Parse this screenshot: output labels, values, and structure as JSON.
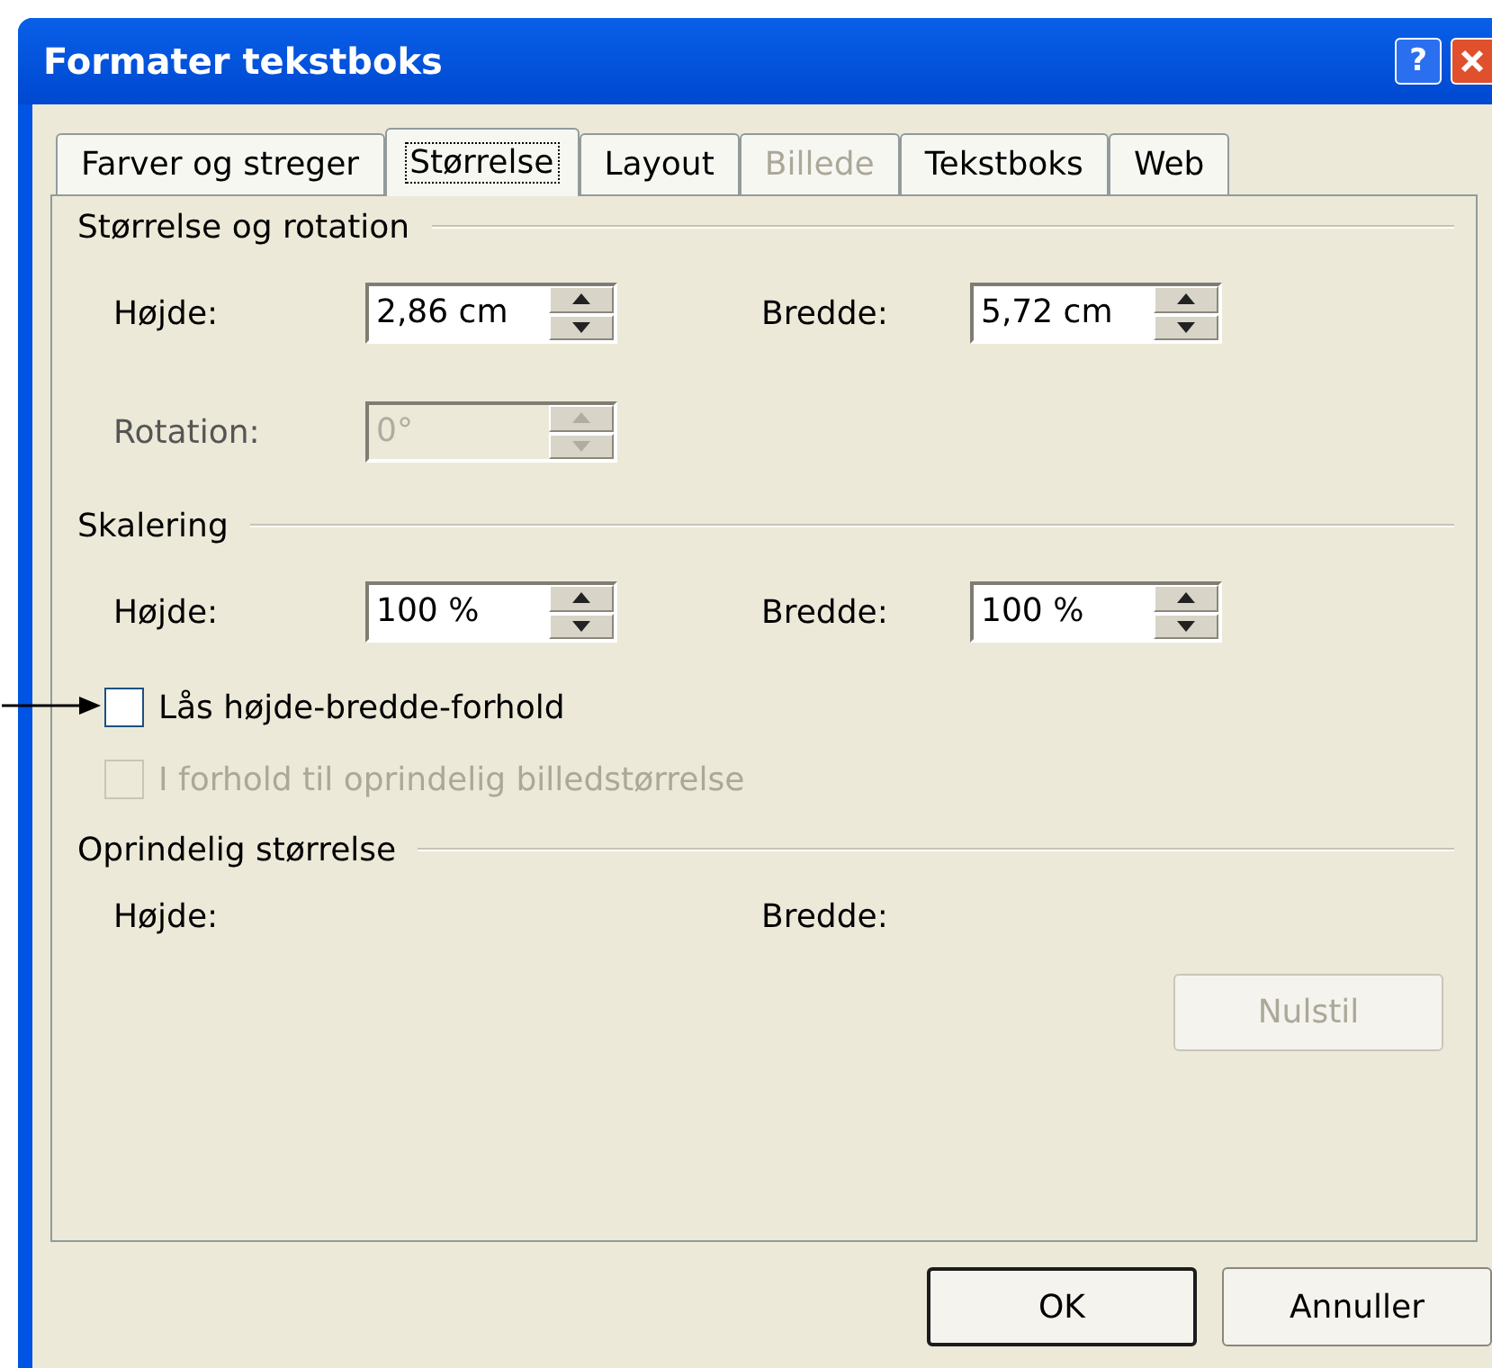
{
  "window": {
    "title": "Formater tekstboks",
    "help": "?"
  },
  "tabs": [
    {
      "label": "Farver og streger",
      "selected": false,
      "disabled": false
    },
    {
      "label": "Størrelse",
      "selected": true,
      "disabled": false
    },
    {
      "label": "Layout",
      "selected": false,
      "disabled": false
    },
    {
      "label": "Billede",
      "selected": false,
      "disabled": true
    },
    {
      "label": "Tekstboks",
      "selected": false,
      "disabled": false
    },
    {
      "label": "Web",
      "selected": false,
      "disabled": false
    }
  ],
  "sections": [
    {
      "title": "Størrelse og rotation",
      "items": [
        {
          "kind": "spinners",
          "fields": [
            {
              "label": "Højde:",
              "value": "2,86 cm",
              "disabled": false
            },
            {
              "label": "Bredde:",
              "value": "5,72 cm",
              "disabled": false
            }
          ]
        },
        {
          "kind": "spinners",
          "fields": [
            {
              "label": "Rotation:",
              "value": "0°",
              "disabled": true
            }
          ]
        }
      ]
    },
    {
      "title": "Skalering",
      "items": [
        {
          "kind": "spinners",
          "fields": [
            {
              "label": "Højde:",
              "value": "100 %",
              "disabled": false
            },
            {
              "label": "Bredde:",
              "value": "100 %",
              "disabled": false
            }
          ]
        },
        {
          "kind": "checkbox",
          "label": "Lås højde-bredde-forhold",
          "checked": false,
          "disabled": false,
          "annotated": true
        },
        {
          "kind": "checkbox",
          "label": "I forhold til oprindelig billedstørrelse",
          "checked": false,
          "disabled": true,
          "annotated": false
        }
      ]
    },
    {
      "title": "Oprindelig størrelse",
      "items": [
        {
          "kind": "labels",
          "labels": [
            "Højde:",
            "Bredde:"
          ]
        },
        {
          "kind": "button",
          "label": "Nulstil",
          "disabled": true
        }
      ]
    }
  ],
  "buttons": [
    {
      "label": "OK",
      "default": true
    },
    {
      "label": "Annuller",
      "default": false
    }
  ]
}
